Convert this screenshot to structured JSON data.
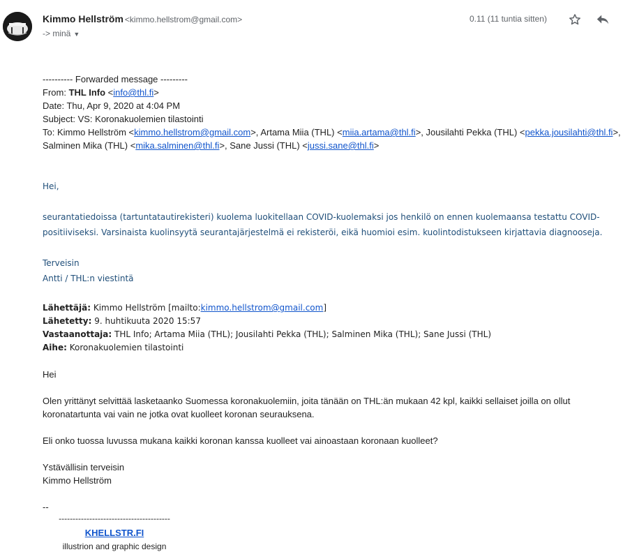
{
  "header": {
    "sender_name": "Kimmo Hellström",
    "sender_email": "<kimmo.hellstrom@gmail.com>",
    "to_line": "-> minä",
    "date": "0.11 (11 tuntia sitten)",
    "star_icon": "star-icon",
    "reply_icon": "reply-icon"
  },
  "forward": {
    "divider": "---------- Forwarded message ---------",
    "from_label": "From: ",
    "from_name": "THL Info",
    "from_email": "info@thl.fi",
    "date_line": "Date: Thu, Apr 9, 2020 at 4:04 PM",
    "subject_line": "Subject: VS: Koronakuolemien tilastointi",
    "to_label": "To: ",
    "to_recipients": [
      {
        "name": "Kimmo Hellström",
        "email": "kimmo.hellstrom@gmail.com"
      },
      {
        "name": "Artama Miia (THL)",
        "email": "miia.artama@thl.fi"
      },
      {
        "name": "Jousilahti Pekka (THL)",
        "email": "pekka.jousilahti@thl.fi"
      },
      {
        "name": "Salminen Mika (THL)",
        "email": "mika.salminen@thl.fi"
      },
      {
        "name": "Sane Jussi (THL)",
        "email": "jussi.sane@thl.fi"
      }
    ]
  },
  "reply": {
    "greeting": "Hei,",
    "line1": "seurantatiedoissa (tartuntatautirekisteri) kuolema luokitellaan COVID-kuolemaksi jos henkilö on ennen kuolemaansa testattu COVID-",
    "line2": "positiiviseksi. Varsinaista kuolinsyytä seurantajärjestelmä ei rekisteröi, eikä huomioi esim. kuolintodistukseen kirjattavia diagnooseja.",
    "closing": "Terveisin",
    "signature": "Antti / THL:n viestintä"
  },
  "original": {
    "sender_label": "Lähettäjä:",
    "sender_value": "Kimmo Hellström [mailto:",
    "sender_email": "kimmo.hellstrom@gmail.com",
    "sent_label": "Lähetetty:",
    "sent_value": "9. huhtikuuta 2020 15:57",
    "recipients_label": "Vastaanottaja:",
    "recipients_value": "THL Info; Artama Miia (THL); Jousilahti Pekka (THL); Salminen Mika (THL); Sane Jussi (THL)",
    "subject_label": "Aihe:",
    "subject_value": "Koronakuolemien tilastointi",
    "greeting": "Hei",
    "para1_line1": "Olen yrittänyt selvittää lasketaanko Suomessa koronakuolemiin, joita tänään on THL:än mukaan 42 kpl, kaikki sellaiset joilla on ollut",
    "para1_line2": "koronatartunta vai vain ne jotka ovat kuolleet koronan seurauksena.",
    "para2": "Eli onko tuossa luvussa mukana kaikki koronan kanssa kuolleet vai ainoastaan koronaan kuolleet?",
    "closing": "Ystävällisin terveisin",
    "name": "Kimmo Hellström",
    "sig_dashes": "--",
    "sig_rule": "----------------------------------------",
    "sig_site": "KHELLSTR.FI",
    "sig_tagline": "illustrion and graphic design"
  }
}
